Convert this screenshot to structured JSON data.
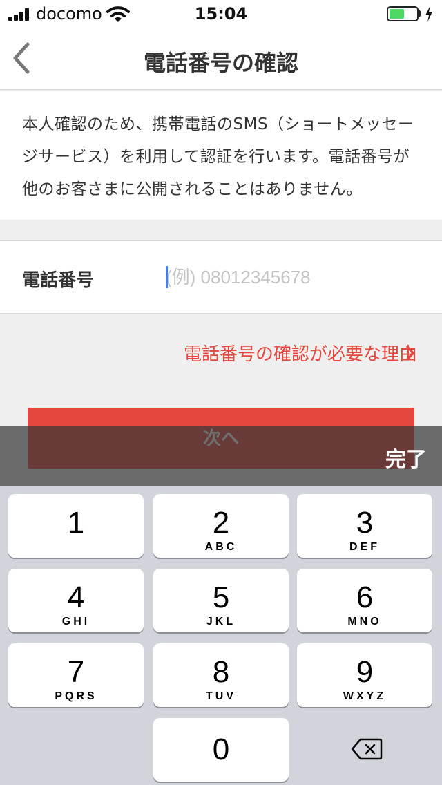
{
  "status_bar": {
    "carrier": "docomo",
    "time": "15:04",
    "battery_level": 0.55,
    "battery_color": "#4cd964"
  },
  "nav": {
    "back_icon": "chevron-left-icon",
    "title": "電話番号の確認"
  },
  "intro": {
    "text": "本人確認のため、携帯電話のSMS（ショートメッセージサービス）を利用して認証を行います。電話番号が他のお客さまに公開されることはありません。"
  },
  "form": {
    "phone_label": "電話番号",
    "phone_placeholder": "(例) 08012345678",
    "phone_value": ""
  },
  "reason_link": {
    "label": "電話番号の確認が必要な理由",
    "icon": "chevron-right-icon"
  },
  "next_button": {
    "label": "次へ"
  },
  "keyboard": {
    "done_label": "完了",
    "keys": [
      {
        "digit": "1",
        "letters": ""
      },
      {
        "digit": "2",
        "letters": "ABC"
      },
      {
        "digit": "3",
        "letters": "DEF"
      },
      {
        "digit": "4",
        "letters": "GHI"
      },
      {
        "digit": "5",
        "letters": "JKL"
      },
      {
        "digit": "6",
        "letters": "MNO"
      },
      {
        "digit": "7",
        "letters": "PQRS"
      },
      {
        "digit": "8",
        "letters": "TUV"
      },
      {
        "digit": "9",
        "letters": "WXYZ"
      },
      {
        "digit": "0",
        "letters": ""
      }
    ],
    "delete_icon": "backspace-icon"
  },
  "colors": {
    "accent": "#e5463d",
    "caret": "#3f7ff2",
    "keyboard_bg": "#d1d4da"
  }
}
